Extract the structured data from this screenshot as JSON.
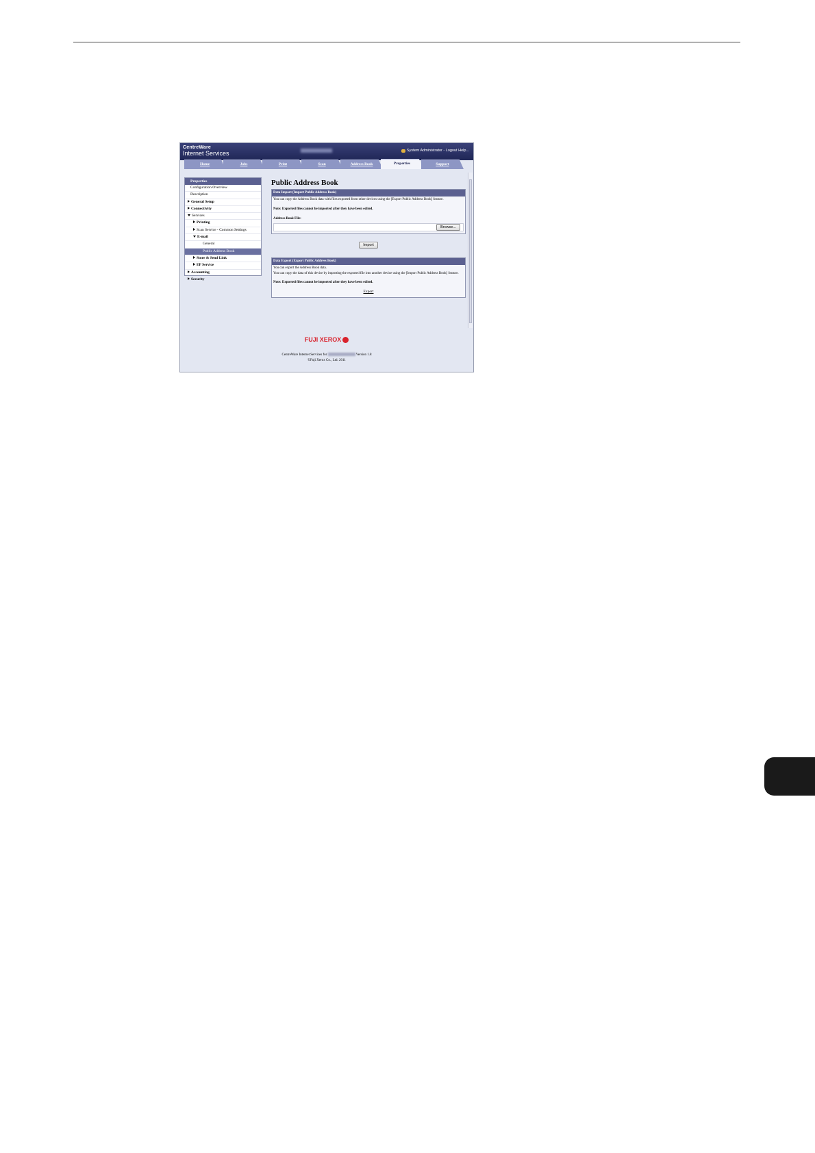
{
  "app": {
    "brand_line1": "CentreWare",
    "brand_line2": "Internet Services",
    "user_links": "System Administrator - Logout Help..."
  },
  "tabs": [
    {
      "label": "Home",
      "active": false
    },
    {
      "label": "Jobs",
      "active": false
    },
    {
      "label": "Print",
      "active": false
    },
    {
      "label": "Scan",
      "active": false
    },
    {
      "label": "Address Book",
      "active": false
    },
    {
      "label": "Properties",
      "active": true
    },
    {
      "label": "Support",
      "active": false
    }
  ],
  "nav": {
    "header": "Properties",
    "items": [
      {
        "label": "Configuration Overview"
      },
      {
        "label": "Description"
      },
      {
        "label": "General Setup"
      },
      {
        "label": "Connectivity"
      },
      {
        "label": "Services"
      },
      {
        "label": "Printing"
      },
      {
        "label": "Scan Service - Common Settings"
      },
      {
        "label": "E-mail"
      },
      {
        "label": "General"
      },
      {
        "label": "Public Address Book"
      },
      {
        "label": "Store & Send Link"
      },
      {
        "label": "EP Service"
      },
      {
        "label": "Accounting"
      },
      {
        "label": "Security"
      }
    ]
  },
  "main": {
    "title": "Public Address Book",
    "import": {
      "heading": "Data Import (Import Public Address Book)",
      "desc": "You can copy the Address Book data with files exported from other devices using the [Export Public Address Book] feature.",
      "note": "Note: Exported files cannot be imported after they have been edited.",
      "file_label": "Address Book File:",
      "browse_label": "Browse...",
      "import_label": "Import"
    },
    "export": {
      "heading": "Data Export (Export Public Address Book)",
      "desc1": "You can export the Address Book data.",
      "desc2": "You can copy the data of this device by importing the exported file into another device using the [Import Public Address Book] feature.",
      "note": "Note: Exported files cannot be imported after they have been edited.",
      "export_label": "Export"
    }
  },
  "footer": {
    "logo_text": "FUJI XEROX",
    "line1_prefix": "CentreWare Internet Services for",
    "line1_suffix": "Version 1.8",
    "line2": "©Fuji Xerox Co., Ltd. 2011"
  },
  "colors": {
    "header_bg": "#2a3068",
    "tab_bg": "#8d96c4",
    "panel_head": "#5b6090",
    "brand_red": "#d9232d"
  }
}
